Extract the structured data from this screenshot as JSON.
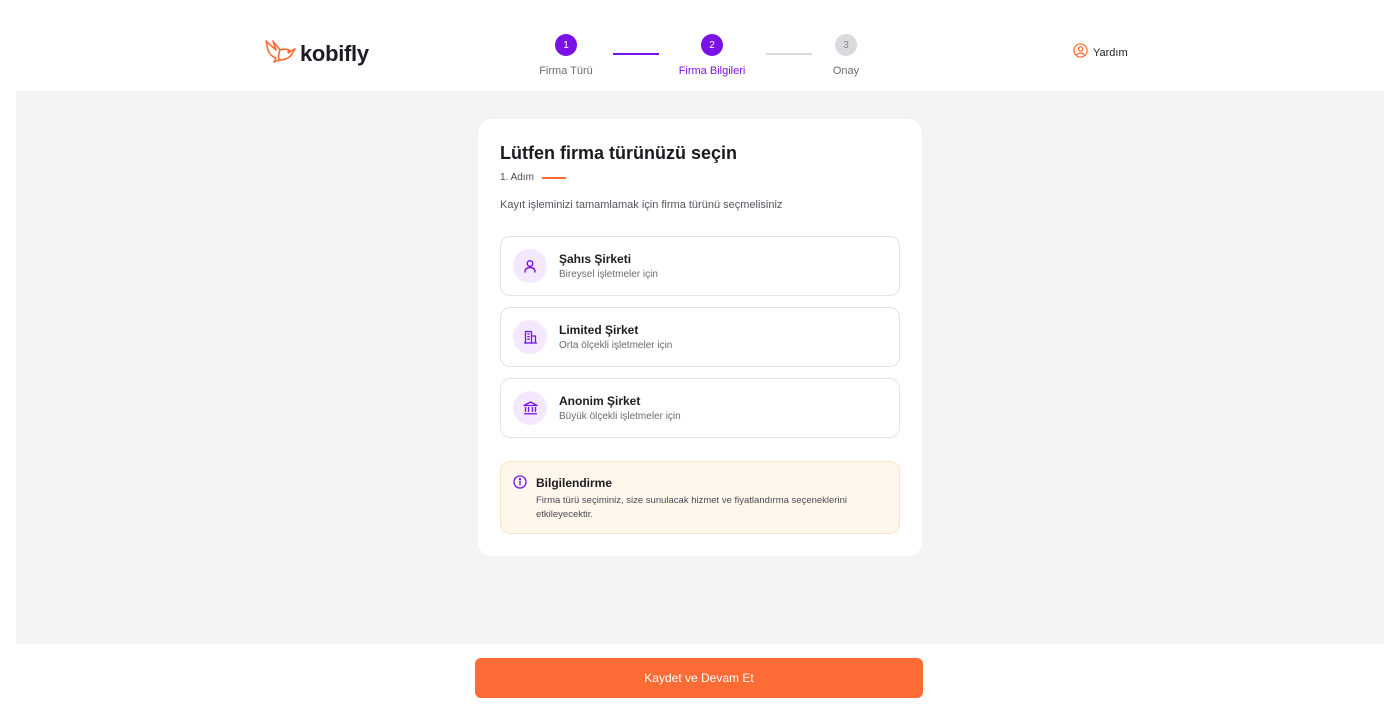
{
  "brand": {
    "name": "kobifly",
    "accent": "#7a12e8",
    "primary": "#ff6b35"
  },
  "stepper": {
    "steps": [
      {
        "number": "1",
        "label": "Firma Türü"
      },
      {
        "number": "2",
        "label": "Firma Bilgileri"
      },
      {
        "number": "3",
        "label": "Onay"
      }
    ]
  },
  "header": {
    "help_label": "Yardım",
    "help_icon": "user-circle-icon"
  },
  "card": {
    "title": "Lütfen firma türünüzü seçin",
    "step_text": "1. Adım",
    "description": "Kayıt işleminizi tamamlamak için firma türünü seçmelisiniz",
    "options": [
      {
        "title": "Şahıs Şirketi",
        "subtitle": "Bireysel işletmeler için",
        "icon": "person-icon"
      },
      {
        "title": "Limited Şirket",
        "subtitle": "Orta ölçekli işletmeler için",
        "icon": "building-icon"
      },
      {
        "title": "Anonim Şirket",
        "subtitle": "Büyük ölçekli işletmeler için",
        "icon": "bank-icon"
      }
    ],
    "info": {
      "title": "Bilgilendirme",
      "text": "Firma türü seçiminiz, size sunulacak hizmet ve fiyatlandırma seçeneklerini etkileyecektir.",
      "icon": "info-icon"
    }
  },
  "footer": {
    "primary_label": "Kaydet ve Devam Et"
  }
}
